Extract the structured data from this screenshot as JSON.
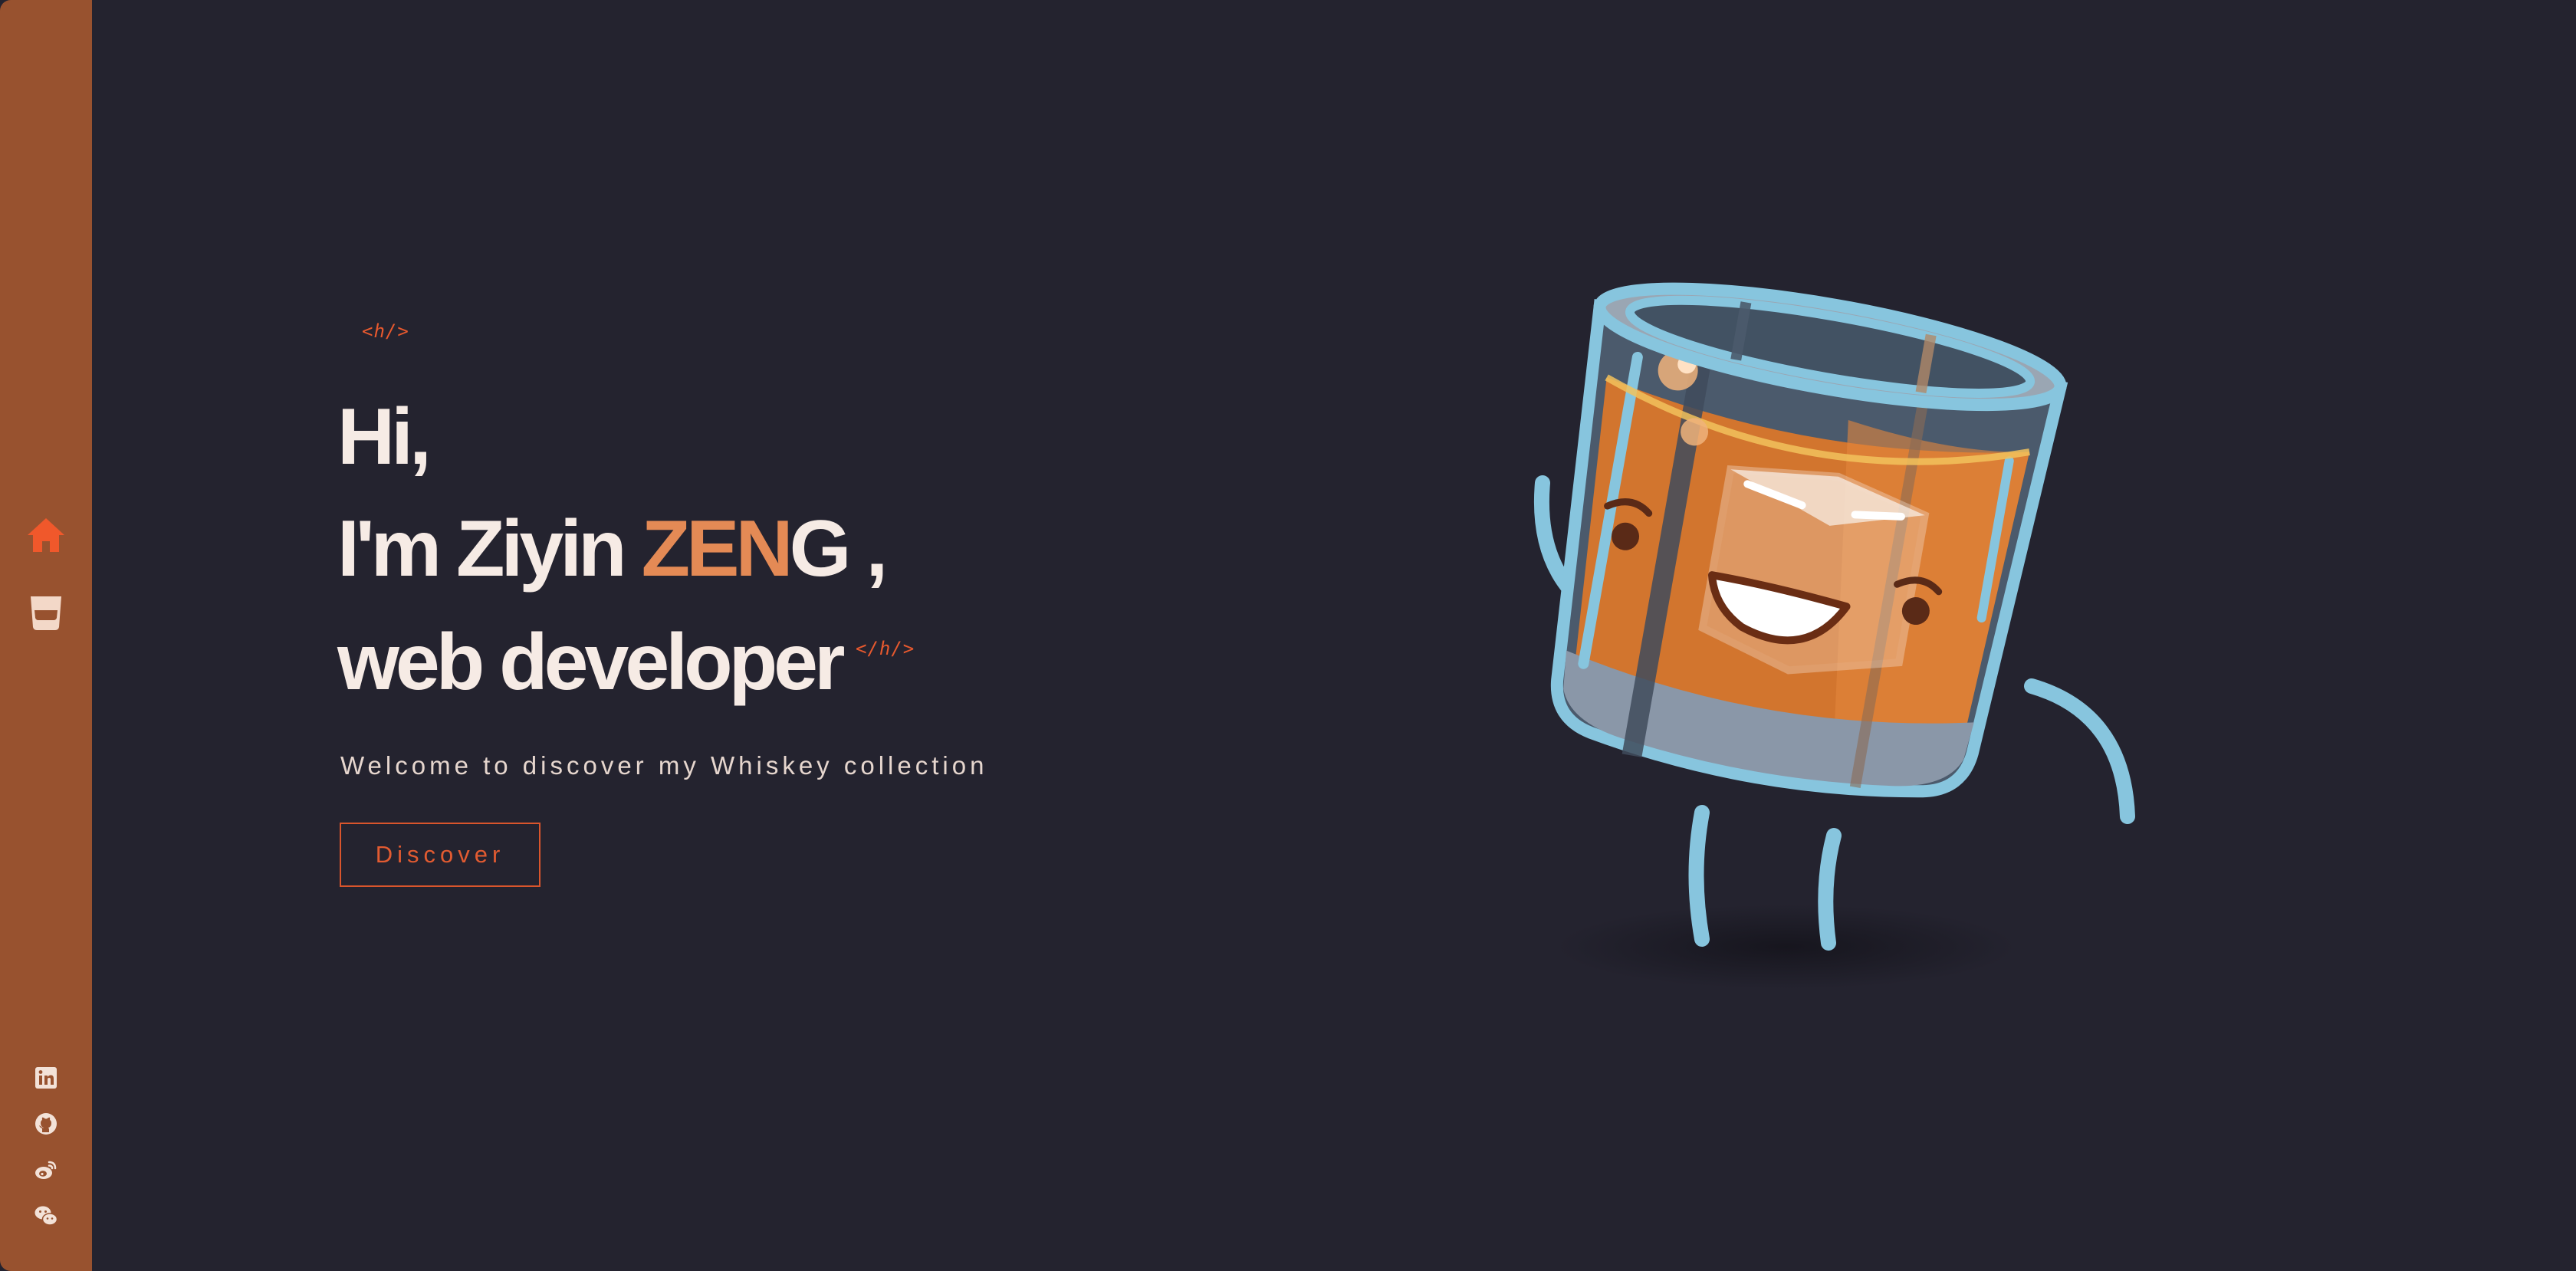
{
  "sidebar": {
    "nav": [
      {
        "icon": "home-icon",
        "active": true
      },
      {
        "icon": "whiskey-glass-icon",
        "active": false
      }
    ],
    "social": [
      {
        "icon": "linkedin-icon"
      },
      {
        "icon": "github-icon"
      },
      {
        "icon": "weibo-icon"
      },
      {
        "icon": "wechat-icon"
      }
    ]
  },
  "hero": {
    "open_tag": "<h/>",
    "line1": "Hi,",
    "line2_prefix": "I'm Ziyin ",
    "line2_accent": "ZEN",
    "line2_suffix": "G ,",
    "line3": "web developer",
    "close_tag": "</h/>",
    "subtitle": "Welcome to discover my Whiskey collection",
    "button_label": "Discover"
  },
  "colors": {
    "background": "#24232f",
    "sidebar": "#98522f",
    "accent": "#e8592e",
    "name_highlight": "#e48a55",
    "text": "#f6ebe5"
  }
}
